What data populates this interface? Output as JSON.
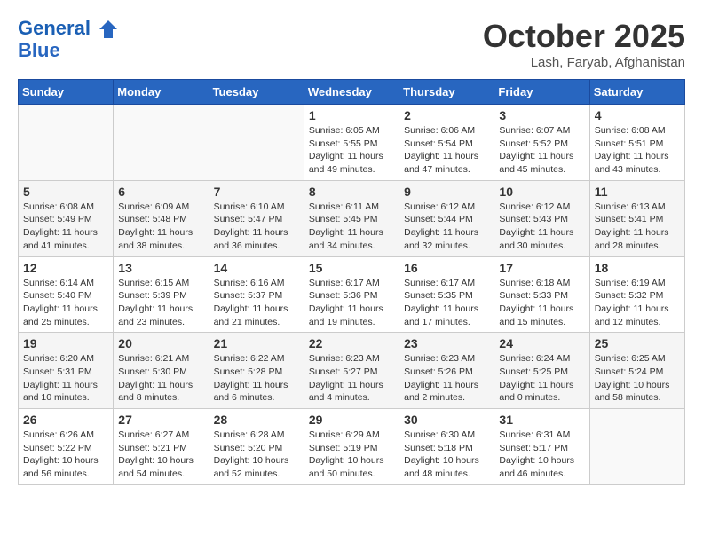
{
  "header": {
    "logo_line1": "General",
    "logo_line2": "Blue",
    "month_title": "October 2025",
    "location": "Lash, Faryab, Afghanistan"
  },
  "weekdays": [
    "Sunday",
    "Monday",
    "Tuesday",
    "Wednesday",
    "Thursday",
    "Friday",
    "Saturday"
  ],
  "weeks": [
    [
      {
        "day": "",
        "info": ""
      },
      {
        "day": "",
        "info": ""
      },
      {
        "day": "",
        "info": ""
      },
      {
        "day": "1",
        "info": "Sunrise: 6:05 AM\nSunset: 5:55 PM\nDaylight: 11 hours\nand 49 minutes."
      },
      {
        "day": "2",
        "info": "Sunrise: 6:06 AM\nSunset: 5:54 PM\nDaylight: 11 hours\nand 47 minutes."
      },
      {
        "day": "3",
        "info": "Sunrise: 6:07 AM\nSunset: 5:52 PM\nDaylight: 11 hours\nand 45 minutes."
      },
      {
        "day": "4",
        "info": "Sunrise: 6:08 AM\nSunset: 5:51 PM\nDaylight: 11 hours\nand 43 minutes."
      }
    ],
    [
      {
        "day": "5",
        "info": "Sunrise: 6:08 AM\nSunset: 5:49 PM\nDaylight: 11 hours\nand 41 minutes."
      },
      {
        "day": "6",
        "info": "Sunrise: 6:09 AM\nSunset: 5:48 PM\nDaylight: 11 hours\nand 38 minutes."
      },
      {
        "day": "7",
        "info": "Sunrise: 6:10 AM\nSunset: 5:47 PM\nDaylight: 11 hours\nand 36 minutes."
      },
      {
        "day": "8",
        "info": "Sunrise: 6:11 AM\nSunset: 5:45 PM\nDaylight: 11 hours\nand 34 minutes."
      },
      {
        "day": "9",
        "info": "Sunrise: 6:12 AM\nSunset: 5:44 PM\nDaylight: 11 hours\nand 32 minutes."
      },
      {
        "day": "10",
        "info": "Sunrise: 6:12 AM\nSunset: 5:43 PM\nDaylight: 11 hours\nand 30 minutes."
      },
      {
        "day": "11",
        "info": "Sunrise: 6:13 AM\nSunset: 5:41 PM\nDaylight: 11 hours\nand 28 minutes."
      }
    ],
    [
      {
        "day": "12",
        "info": "Sunrise: 6:14 AM\nSunset: 5:40 PM\nDaylight: 11 hours\nand 25 minutes."
      },
      {
        "day": "13",
        "info": "Sunrise: 6:15 AM\nSunset: 5:39 PM\nDaylight: 11 hours\nand 23 minutes."
      },
      {
        "day": "14",
        "info": "Sunrise: 6:16 AM\nSunset: 5:37 PM\nDaylight: 11 hours\nand 21 minutes."
      },
      {
        "day": "15",
        "info": "Sunrise: 6:17 AM\nSunset: 5:36 PM\nDaylight: 11 hours\nand 19 minutes."
      },
      {
        "day": "16",
        "info": "Sunrise: 6:17 AM\nSunset: 5:35 PM\nDaylight: 11 hours\nand 17 minutes."
      },
      {
        "day": "17",
        "info": "Sunrise: 6:18 AM\nSunset: 5:33 PM\nDaylight: 11 hours\nand 15 minutes."
      },
      {
        "day": "18",
        "info": "Sunrise: 6:19 AM\nSunset: 5:32 PM\nDaylight: 11 hours\nand 12 minutes."
      }
    ],
    [
      {
        "day": "19",
        "info": "Sunrise: 6:20 AM\nSunset: 5:31 PM\nDaylight: 11 hours\nand 10 minutes."
      },
      {
        "day": "20",
        "info": "Sunrise: 6:21 AM\nSunset: 5:30 PM\nDaylight: 11 hours\nand 8 minutes."
      },
      {
        "day": "21",
        "info": "Sunrise: 6:22 AM\nSunset: 5:28 PM\nDaylight: 11 hours\nand 6 minutes."
      },
      {
        "day": "22",
        "info": "Sunrise: 6:23 AM\nSunset: 5:27 PM\nDaylight: 11 hours\nand 4 minutes."
      },
      {
        "day": "23",
        "info": "Sunrise: 6:23 AM\nSunset: 5:26 PM\nDaylight: 11 hours\nand 2 minutes."
      },
      {
        "day": "24",
        "info": "Sunrise: 6:24 AM\nSunset: 5:25 PM\nDaylight: 11 hours\nand 0 minutes."
      },
      {
        "day": "25",
        "info": "Sunrise: 6:25 AM\nSunset: 5:24 PM\nDaylight: 10 hours\nand 58 minutes."
      }
    ],
    [
      {
        "day": "26",
        "info": "Sunrise: 6:26 AM\nSunset: 5:22 PM\nDaylight: 10 hours\nand 56 minutes."
      },
      {
        "day": "27",
        "info": "Sunrise: 6:27 AM\nSunset: 5:21 PM\nDaylight: 10 hours\nand 54 minutes."
      },
      {
        "day": "28",
        "info": "Sunrise: 6:28 AM\nSunset: 5:20 PM\nDaylight: 10 hours\nand 52 minutes."
      },
      {
        "day": "29",
        "info": "Sunrise: 6:29 AM\nSunset: 5:19 PM\nDaylight: 10 hours\nand 50 minutes."
      },
      {
        "day": "30",
        "info": "Sunrise: 6:30 AM\nSunset: 5:18 PM\nDaylight: 10 hours\nand 48 minutes."
      },
      {
        "day": "31",
        "info": "Sunrise: 6:31 AM\nSunset: 5:17 PM\nDaylight: 10 hours\nand 46 minutes."
      },
      {
        "day": "",
        "info": ""
      }
    ]
  ]
}
